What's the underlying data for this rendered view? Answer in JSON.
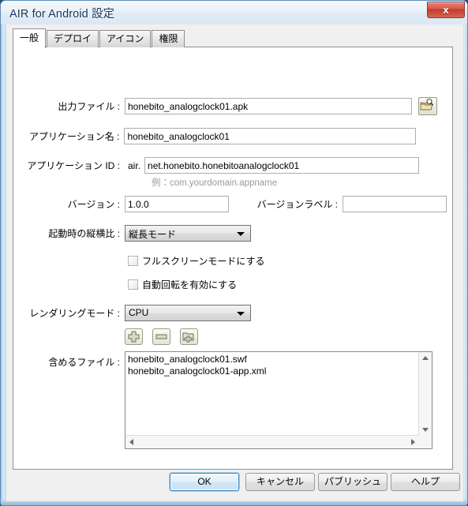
{
  "window": {
    "title": "AIR for Android 設定",
    "close_label": "x"
  },
  "tabs": [
    {
      "label": "一般",
      "active": true
    },
    {
      "label": "デプロイ",
      "active": false
    },
    {
      "label": "アイコン",
      "active": false
    },
    {
      "label": "権限",
      "active": false
    }
  ],
  "form": {
    "output_file": {
      "label": "出力ファイル :",
      "value": "honebito_analogclock01.apk",
      "browse_icon": "folder-search-icon"
    },
    "app_name": {
      "label": "アプリケーション名 :",
      "value": "honebito_analogclock01"
    },
    "app_id": {
      "label": "アプリケーション ID :",
      "prefix": "air.",
      "value": "net.honebito.honebitoanalogclock01",
      "hint": "例：com.yourdomain.appname"
    },
    "version": {
      "label": "バージョン :",
      "value": "1.0.0"
    },
    "version_label": {
      "label": "バージョンラベル :",
      "value": ""
    },
    "aspect_ratio": {
      "label": "起動時の縦横比 :",
      "value": "縦長モード"
    },
    "fullscreen": {
      "label": "フルスクリーンモードにする",
      "checked": false
    },
    "autorotate": {
      "label": "自動回転を有効にする",
      "checked": false
    },
    "render_mode": {
      "label": "レンダリングモード :",
      "value": "CPU"
    },
    "included_files": {
      "label": "含めるファイル :",
      "items": [
        "honebito_analogclock01.swf",
        "honebito_analogclock01-app.xml"
      ]
    }
  },
  "list_toolbar": {
    "add": "plus-icon",
    "remove": "minus-icon",
    "add_folder": "add-folder-icon"
  },
  "buttons": {
    "ok": "OK",
    "cancel": "キャンセル",
    "publish": "パブリッシュ",
    "help": "ヘルプ"
  }
}
